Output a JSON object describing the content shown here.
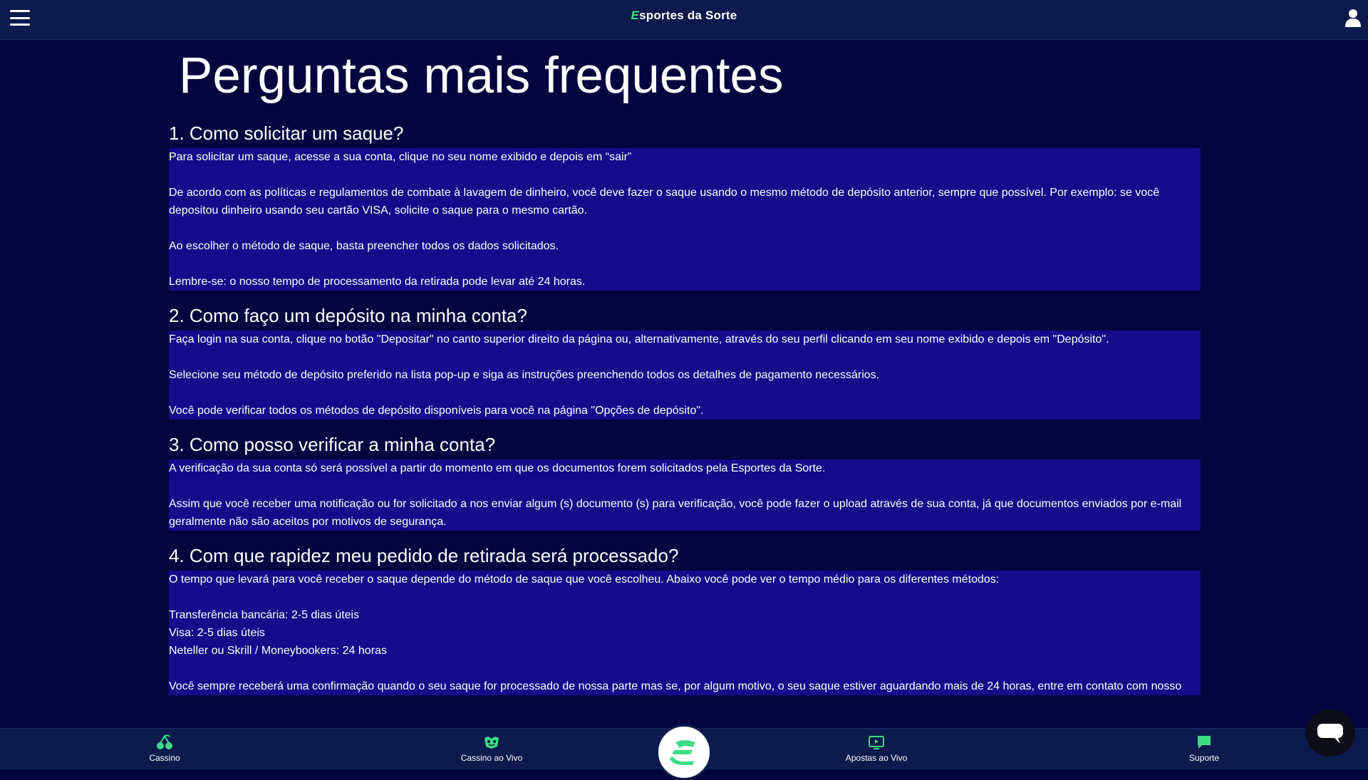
{
  "header": {
    "brand_prefix": "E",
    "brand_rest": "sportes da Sorte"
  },
  "main": {
    "title": "Perguntas mais frequentes",
    "faqs": [
      {
        "question": "1. Como solicitar um saque?",
        "paragraphs": [
          "Para solicitar um saque, acesse a sua conta, clique no seu nome exibido e depois em “sair”",
          "De acordo com as políticas e regulamentos de combate à lavagem de dinheiro, você deve fazer o saque usando o mesmo método de depósito anterior, sempre que possível. Por exemplo: se você depositou dinheiro usando seu cartão VISA, solicite o saque para o mesmo cartão.",
          "Ao escolher o método de saque, basta preencher todos os dados solicitados.",
          "Lembre-se: o nosso tempo de processamento da retirada pode levar até 24 horas."
        ]
      },
      {
        "question": "2. Como faço um depósito na minha conta?",
        "paragraphs": [
          "Faça login na sua conta, clique no botão \"Depositar\" no canto superior direito da página ou, alternativamente, através do seu perfil clicando em seu nome exibido e depois em \"Depósito\".",
          "Selecione seu método de depósito preferido na lista pop-up e siga as instruções preenchendo todos os detalhes de pagamento necessários.",
          "Você pode verificar todos os métodos de depósito disponíveis para você na página \"Opções de depósito\"."
        ]
      },
      {
        "question": "3. Como posso verificar a minha conta?",
        "paragraphs": [
          "A verificação da sua conta só será possível a partir do momento em que os documentos forem solicitados pela Esportes da Sorte.",
          "Assim que você receber uma notificação ou for solicitado a nos enviar algum (s) documento (s) para verificação, você pode fazer o upload através de sua conta, já que documentos enviados por e-mail geralmente não são aceitos por motivos de segurança."
        ]
      },
      {
        "question": "4. Com que rapidez meu pedido de retirada será processado?",
        "paragraphs": [
          "O tempo que levará para você receber o saque depende do método de saque que você escolheu. Abaixo você pode ver o tempo médio para os diferentes métodos:",
          "Transferência bancária: 2-5 dias úteis",
          "Visa: 2-5 dias úteis",
          "Neteller ou Skrill / Moneybookers: 24 horas",
          "Você sempre receberá uma confirmação quando o seu saque for processado de nossa parte mas se, por algum motivo, o seu saque estiver aguardando mais de 24 horas, entre em contato com nosso"
        ]
      }
    ]
  },
  "bottom_nav": {
    "items": [
      {
        "label": "Cassino",
        "icon": "cherry-icon"
      },
      {
        "label": "Cassino ao Vivo",
        "icon": "live-casino-icon"
      },
      {
        "label": "Apostas ao Vivo",
        "icon": "live-bets-icon"
      },
      {
        "label": "Suporte",
        "icon": "chat-bubble-icon"
      }
    ]
  },
  "colors": {
    "background": "#05043f",
    "header": "#0c1a4d",
    "answer_highlight": "#140a8a",
    "brand_accent": "#3ddc84"
  }
}
